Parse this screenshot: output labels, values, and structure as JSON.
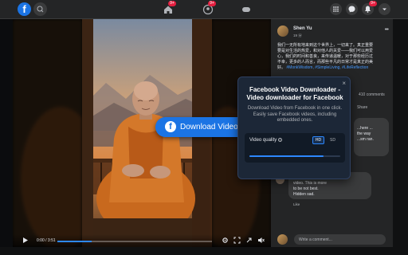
{
  "topbar": {
    "logo_letter": "f",
    "badges": {
      "home": "9+",
      "groups": "9+",
      "notifications": "9+"
    }
  },
  "video": {
    "time": "0:00 / 3:51",
    "progress": 0.22
  },
  "download_button": {
    "label": "Download Video"
  },
  "popup": {
    "close": "×",
    "title": "Facebook Video Downloader - Video downloader for Facebook",
    "description": "Download Video from Facebook in one click. Easily save Facebook videos, including embedded ones.",
    "quality_label": "Video quality",
    "quality_options": [
      "HD",
      "SD"
    ],
    "selected_quality": "HD",
    "load_progress": 0.82
  },
  "post": {
    "author": "Shen Yu",
    "time": "19 分",
    "text": "我们一无所有地来到这个世界上，一切来了。真正重要要是对生活的热爱，和对他人的关爱——我们可以用爱心，我们的时间和善良，来传递温暖，对于那些经历过不幸，更多的人而言，而那些平凡的日常才是真正的美好。",
    "tags": "#MonkWisdom, #SimpleLiving, #LifeReflection",
    "comments_count": "410 comments",
    "share": "Share"
  },
  "comments": [
    {
      "text": "...here ...\nthe way\n...sm ran."
    },
    {
      "text": "Thanks for the love of\nvideo. This is more\nto be not best.\nHidden sad."
    }
  ],
  "comment_actions": {
    "like": "Like"
  },
  "writer": {
    "placeholder": "Write a comment..."
  },
  "colors": {
    "brand": "#1b74e4",
    "accent": "#2d88ff",
    "popup_bg": "#1c2737"
  }
}
